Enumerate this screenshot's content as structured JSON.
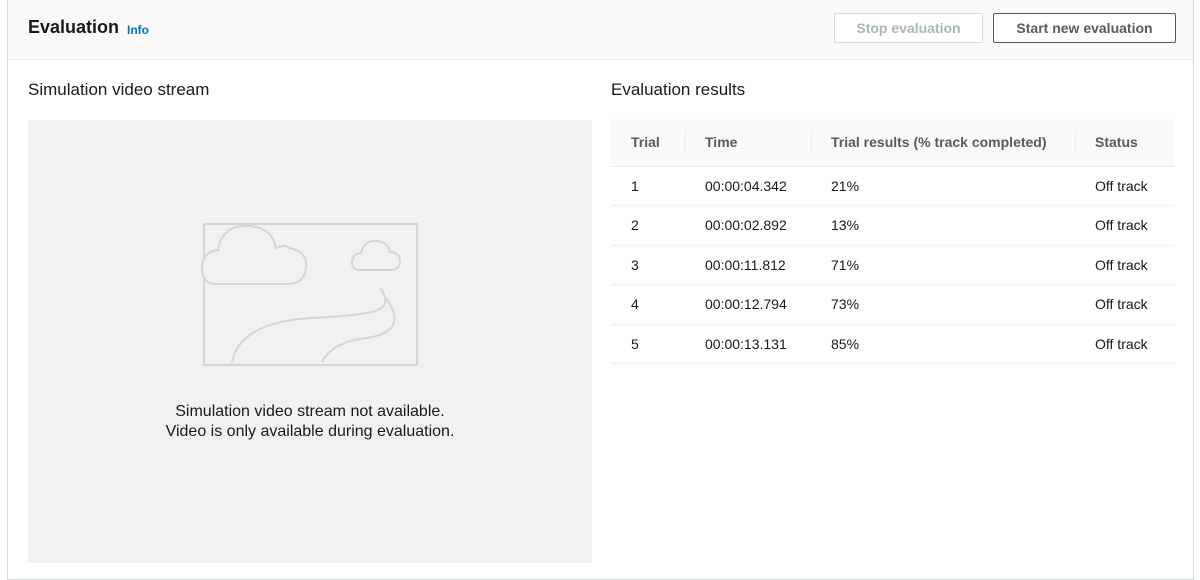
{
  "header": {
    "title": "Evaluation",
    "info_label": "Info",
    "stop_button": "Stop evaluation",
    "start_button": "Start new evaluation"
  },
  "video": {
    "section_title": "Simulation video stream",
    "placeholder_icon": "image-placeholder-icon",
    "message_line1": "Simulation video stream not available.",
    "message_line2": "Video is only available during evaluation."
  },
  "results": {
    "section_title": "Evaluation results",
    "columns": [
      "Trial",
      "Time",
      "Trial results (% track completed)",
      "Status"
    ],
    "rows": [
      {
        "trial": "1",
        "time": "00:00:04.342",
        "result": "21%",
        "status": "Off track"
      },
      {
        "trial": "2",
        "time": "00:00:02.892",
        "result": "13%",
        "status": "Off track"
      },
      {
        "trial": "3",
        "time": "00:00:11.812",
        "result": "71%",
        "status": "Off track"
      },
      {
        "trial": "4",
        "time": "00:00:12.794",
        "result": "73%",
        "status": "Off track"
      },
      {
        "trial": "5",
        "time": "00:00:13.131",
        "result": "85%",
        "status": "Off track"
      }
    ]
  },
  "colors": {
    "link": "#0073bb",
    "disabled_text": "#aab7b8",
    "header_bg": "#fafafa",
    "video_bg": "#f1f1f1"
  }
}
